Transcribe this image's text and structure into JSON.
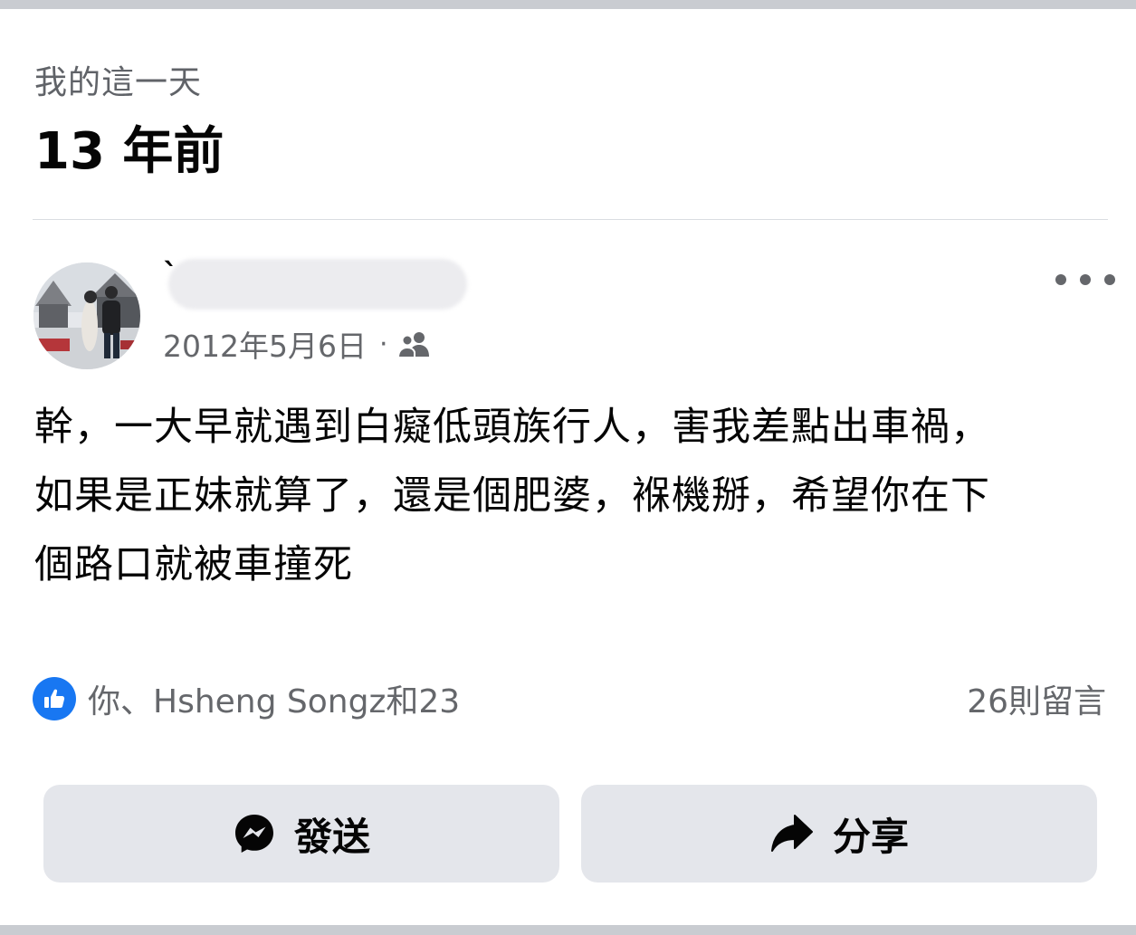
{
  "header": {
    "memory_label": "我的這一天",
    "years_ago": "13 年前"
  },
  "post": {
    "author_visible": "`",
    "date": "2012年5月6日",
    "separator": "·",
    "audience_icon": "friends-icon",
    "more_icon": "more-horizontal-icon",
    "text_lines": [
      "幹，一大早就遇到白癡低頭族行人，害我差點出車禍，",
      "如果是正妹就算了，還是個肥婆，褓機掰，希望你在下",
      "個路口就被車撞死"
    ]
  },
  "reactions": {
    "icon": "like-icon",
    "names": "你、Hsheng Songz和23",
    "comments": "26則留言"
  },
  "actions": {
    "send": {
      "label": "發送",
      "icon": "messenger-icon"
    },
    "share": {
      "label": "分享",
      "icon": "share-arrow-icon"
    }
  },
  "colors": {
    "like_blue": "#1877f2",
    "secondary_text": "#65676b",
    "button_bg": "#e4e6eb",
    "band_gray": "#c9ccd1"
  }
}
